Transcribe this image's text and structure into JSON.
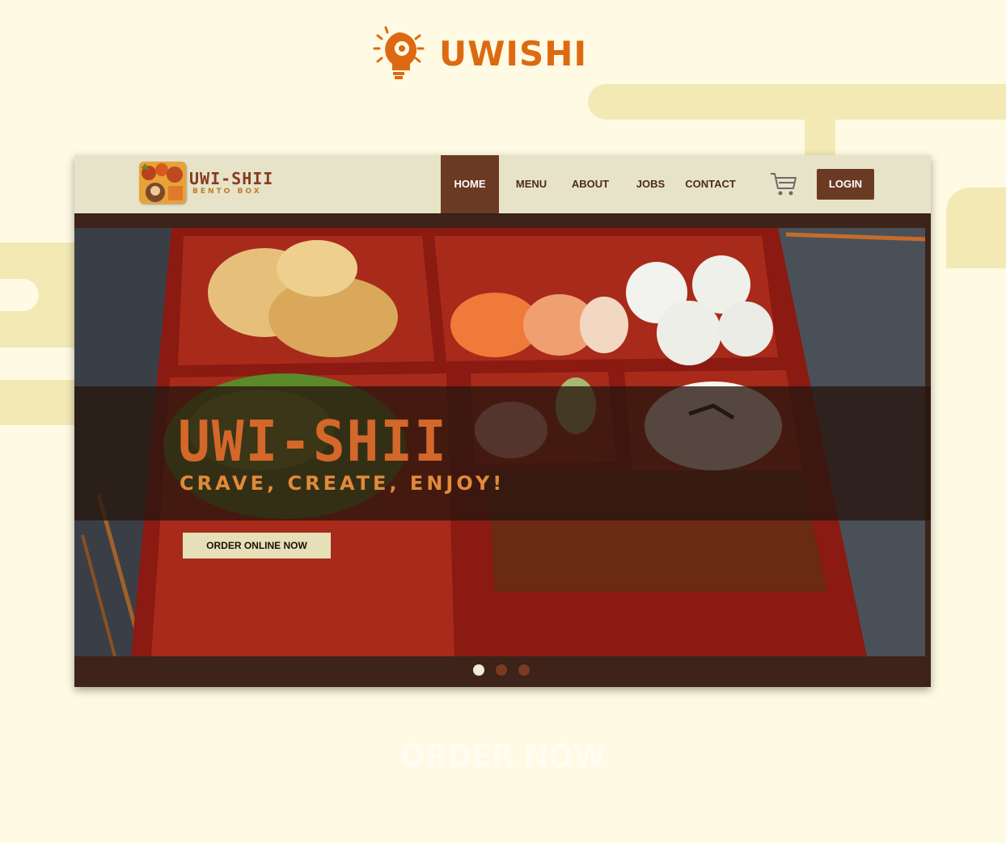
{
  "brand": {
    "name": "UWISHI",
    "icon": "lightbulb-gear-icon"
  },
  "site": {
    "logo": {
      "title": "UWI-SHII",
      "subtitle": "BENTO BOX"
    },
    "nav": {
      "home": "HOME",
      "menu": "MENU",
      "about": "ABOUT",
      "jobs": "JOBS",
      "contact": "CONTACT",
      "login": "LOGIN"
    },
    "hero": {
      "title": "UWI-SHII",
      "tagline": "CRAVE, CREATE, ENJOY!",
      "cta": "ORDER ONLINE NOW"
    },
    "carousel": {
      "slides": 3,
      "active": 1
    }
  },
  "footer": {
    "cta": "ORDER NOW"
  },
  "colors": {
    "background": "#fefae3",
    "brand_orange": "#dd6a12",
    "nav_active": "#6b3a23",
    "window_dark": "#3d2319"
  }
}
